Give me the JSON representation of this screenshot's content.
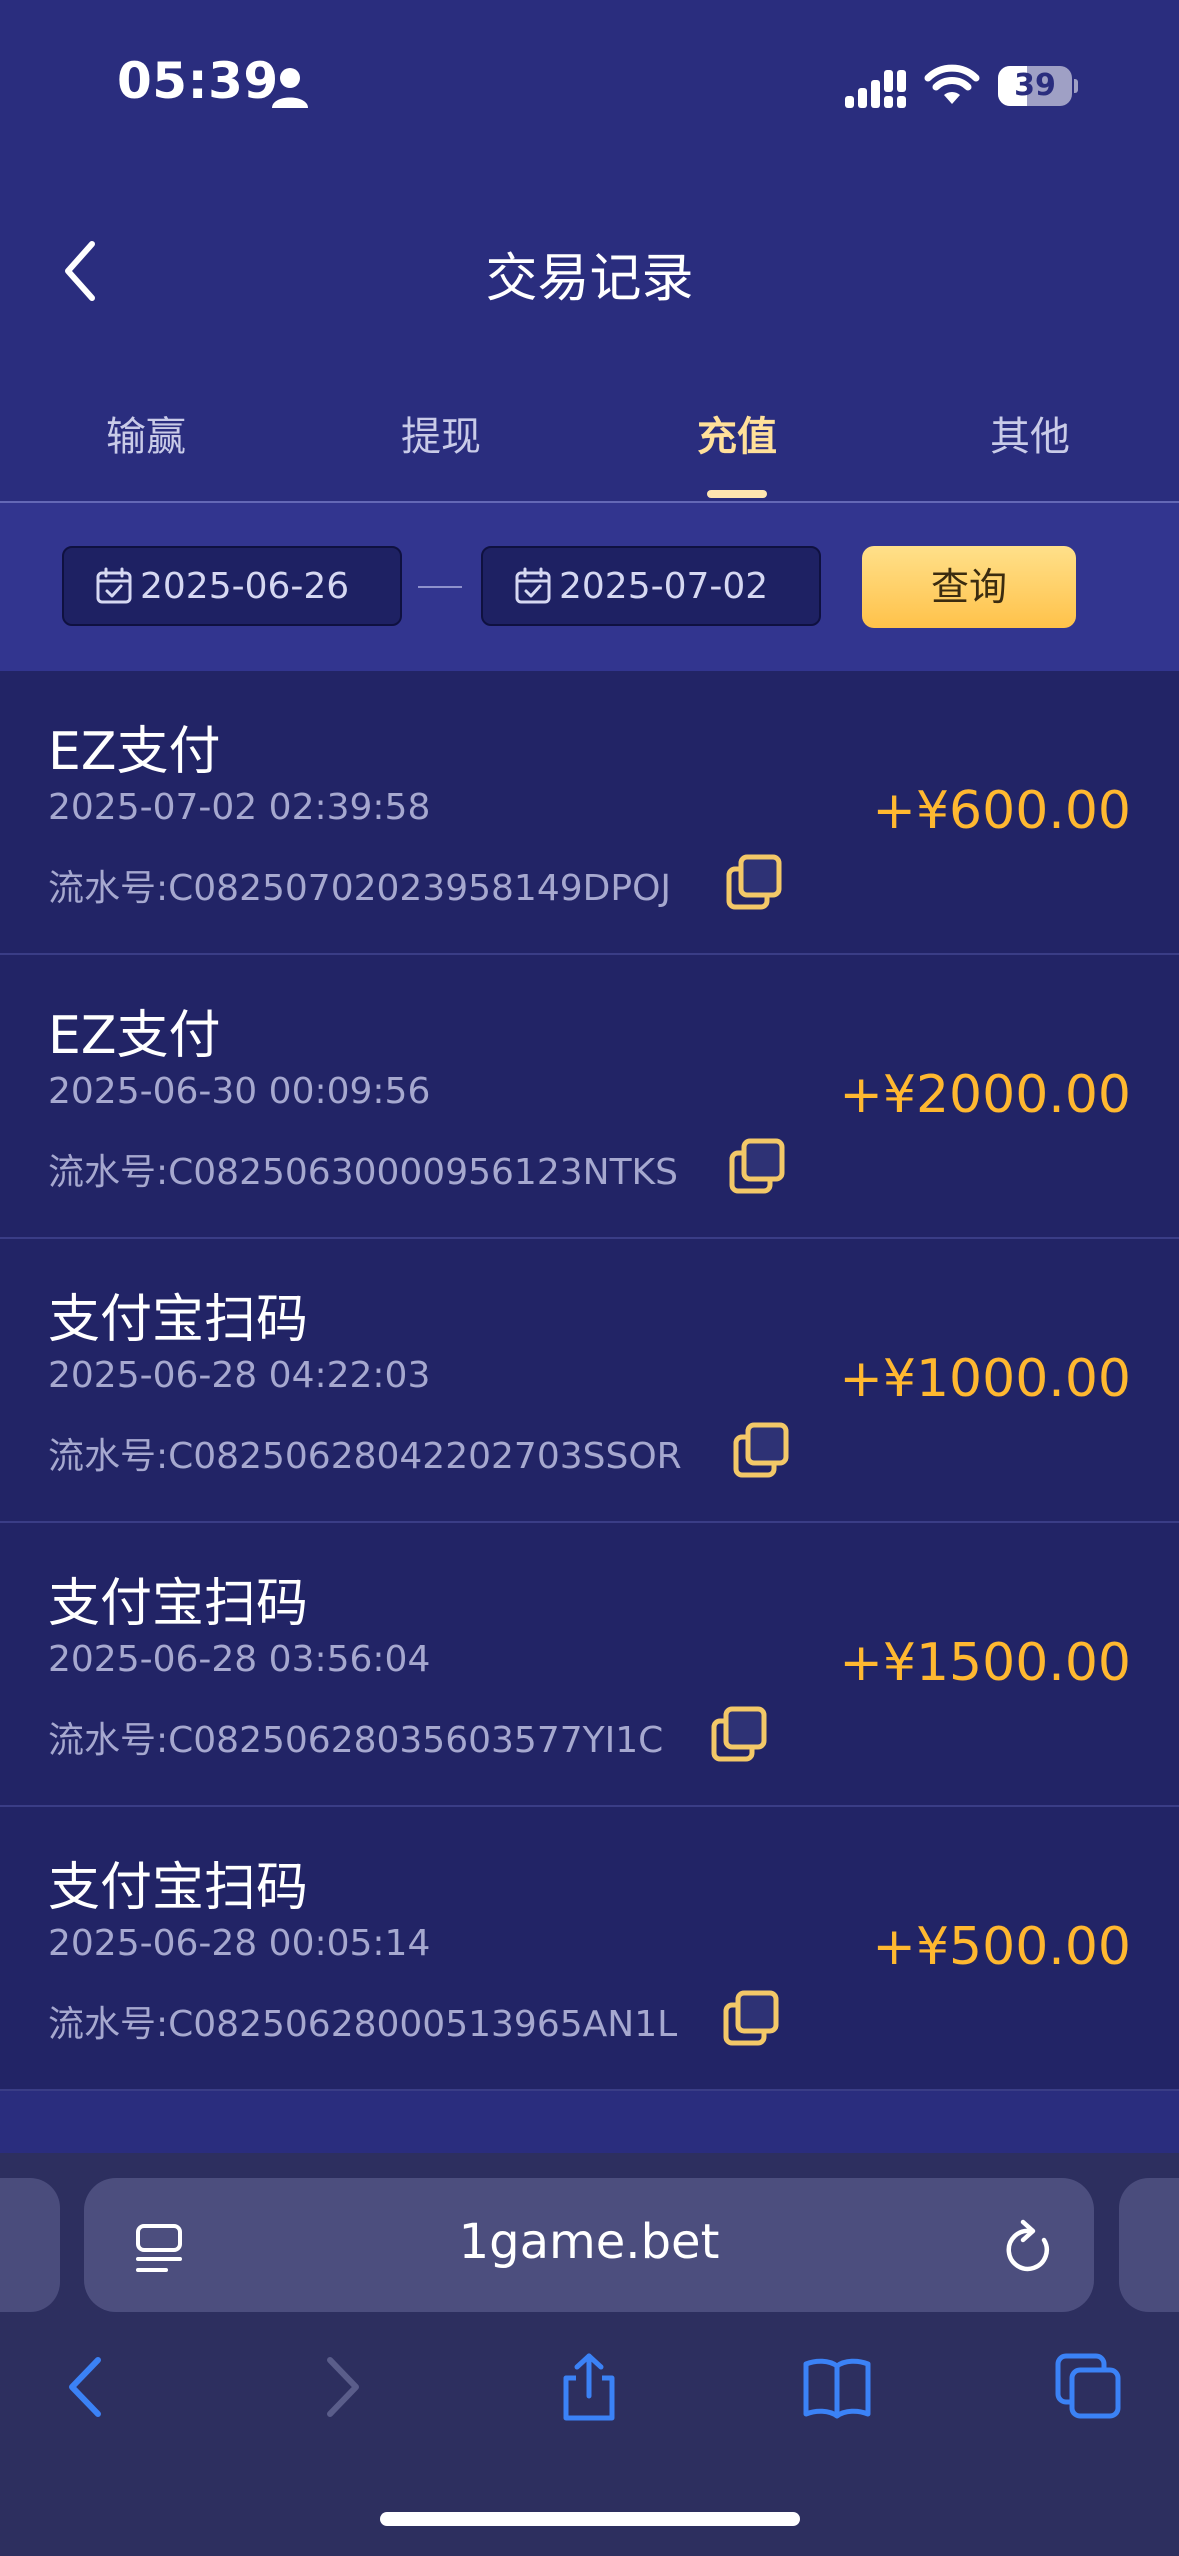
{
  "status_bar": {
    "time": "05:39",
    "battery": "39",
    "battery_level": 0.39
  },
  "header": {
    "title": "交易记录"
  },
  "tabs": [
    {
      "label": "输赢",
      "active": false
    },
    {
      "label": "提现",
      "active": false
    },
    {
      "label": "充值",
      "active": true
    },
    {
      "label": "其他",
      "active": false
    }
  ],
  "filter": {
    "start_date": "2025-06-26",
    "end_date": "2025-07-02",
    "query_label": "查询"
  },
  "transactions": [
    {
      "method": "EZ支付",
      "time": "2025-07-02 02:39:58",
      "serial": "流水号:C08250702023958149DPOJ",
      "amount": "+¥600.00"
    },
    {
      "method": "EZ支付",
      "time": "2025-06-30 00:09:56",
      "serial": "流水号:C08250630000956123NTKS",
      "amount": "+¥2000.00"
    },
    {
      "method": "支付宝扫码",
      "time": "2025-06-28 04:22:03",
      "serial": "流水号:C08250628042202703SSOR",
      "amount": "+¥1000.00"
    },
    {
      "method": "支付宝扫码",
      "time": "2025-06-28 03:56:04",
      "serial": "流水号:C08250628035603577YI1C",
      "amount": "+¥1500.00"
    },
    {
      "method": "支付宝扫码",
      "time": "2025-06-28 00:05:14",
      "serial": "流水号:C08250628000513965AN1L",
      "amount": "+¥500.00"
    }
  ],
  "browser": {
    "url": "1game.bet"
  },
  "colors": {
    "background": "#2a2d7e",
    "row": "#222466",
    "amount": "#ffb830",
    "active_tab": "#ffe09a",
    "query_button": "#ffc24a",
    "safari_blue": "#3b82f6"
  }
}
